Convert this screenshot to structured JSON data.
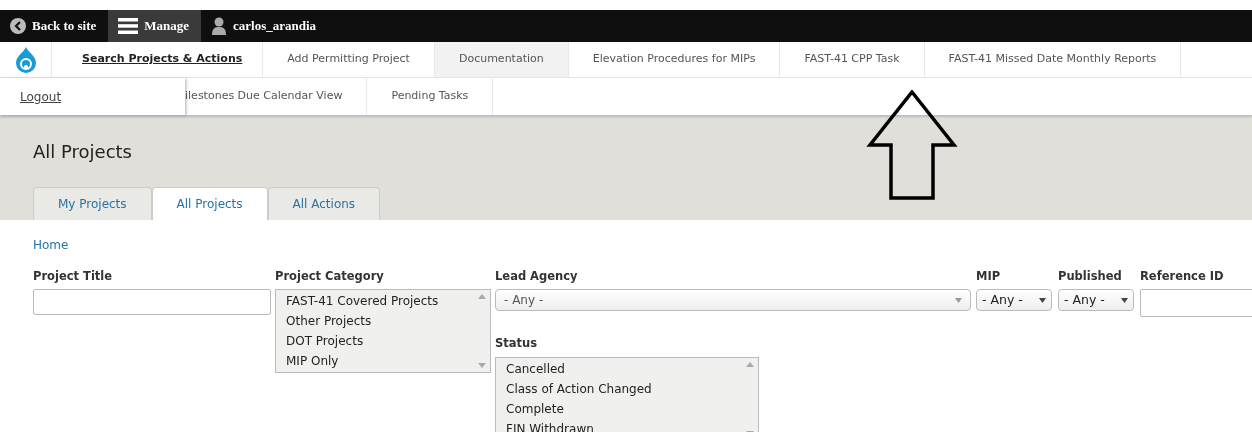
{
  "toolbar": {
    "back": "Back to site",
    "manage": "Manage",
    "user": "carlos_arandia"
  },
  "menu": [
    {
      "label": "Search Projects & Actions",
      "selected": true,
      "highlighted": false
    },
    {
      "label": "Add Permitting Project",
      "selected": false,
      "highlighted": false
    },
    {
      "label": "Documentation",
      "selected": false,
      "highlighted": true
    },
    {
      "label": "Elevation Procedures for MIPs",
      "selected": false,
      "highlighted": false
    },
    {
      "label": "FAST-41 CPP Task",
      "selected": false,
      "highlighted": false
    },
    {
      "label": "FAST-41 Missed Date Monthly Reports",
      "selected": false,
      "highlighted": false
    }
  ],
  "menu_row2": [
    {
      "label": "ilestones Due Calendar View"
    },
    {
      "label": "Pending Tasks"
    }
  ],
  "user_menu": {
    "item": "Logout"
  },
  "page_title": "All Projects",
  "tabs": [
    {
      "label": "My Projects",
      "selected": false
    },
    {
      "label": "All Projects",
      "selected": true
    },
    {
      "label": "All Actions",
      "selected": false
    }
  ],
  "breadcrumb": "Home",
  "filters": {
    "project_title": {
      "label": "Project Title"
    },
    "project_category": {
      "label": "Project Category",
      "options": [
        "FAST-41 Covered Projects",
        "Other Projects",
        "DOT Projects",
        "MIP Only"
      ]
    },
    "lead_agency": {
      "label": "Lead Agency",
      "value": "- Any -"
    },
    "mip": {
      "label": "MIP",
      "value": "- Any -"
    },
    "published": {
      "label": "Published",
      "value": "- Any -"
    },
    "reference_id": {
      "label": "Reference ID"
    },
    "status": {
      "label": "Status",
      "options": [
        "Cancelled",
        "Class of Action Changed",
        "Complete",
        "FIN Withdrawn"
      ]
    }
  }
}
